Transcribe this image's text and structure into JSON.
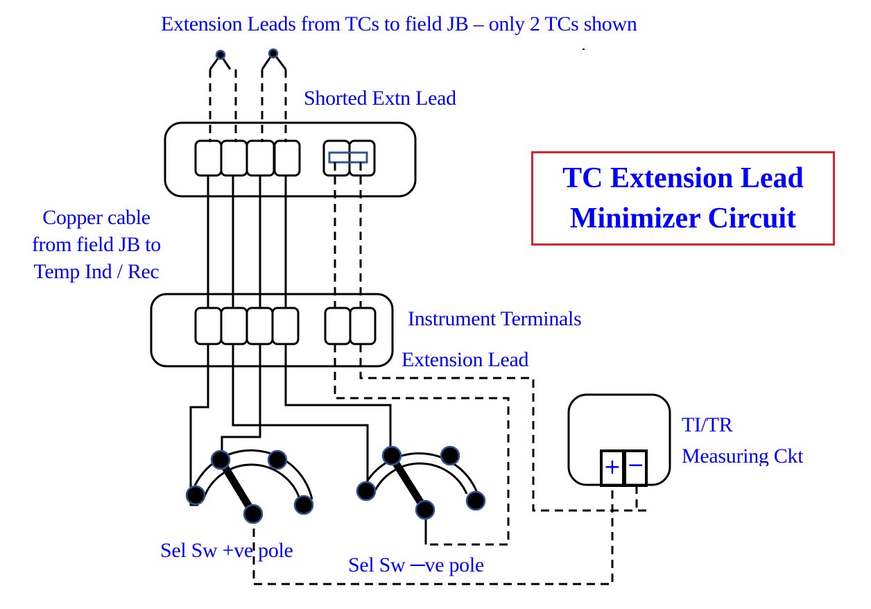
{
  "diagram": {
    "title": {
      "line1": "TC Extension Lead",
      "line2": "Minimizer Circuit"
    },
    "labels": {
      "top_caption": "Extension Leads from TCs to field JB – only 2 TCs shown",
      "shorted_extn_lead": "Shorted Extn Lead",
      "copper_cable_line1": "Copper cable",
      "copper_cable_line2": "from field JB to",
      "copper_cable_line3": "Temp Ind / Rec",
      "instrument_terminals": "Instrument Terminals",
      "extension_lead": "Extension Lead",
      "ti_tr_line1": "TI/TR",
      "ti_tr_line2": "Measuring Ckt",
      "sel_sw_pos": "Sel Sw +ve pole",
      "sel_sw_neg": "Sel Sw ─ve pole"
    },
    "measuring_terminals": {
      "plus": "+",
      "minus": "─"
    },
    "components": {
      "thermocouples_shown": 2,
      "field_jb_terminals": 6,
      "instrument_terminals": 6,
      "selector_switches": [
        "positive-pole",
        "negative-pole"
      ],
      "selector_switch_positions": 4
    },
    "colors": {
      "label_text": "#0000ff",
      "title_border": "#e0202a",
      "wire": "#000000",
      "contact_outline": "#2f5597"
    }
  }
}
